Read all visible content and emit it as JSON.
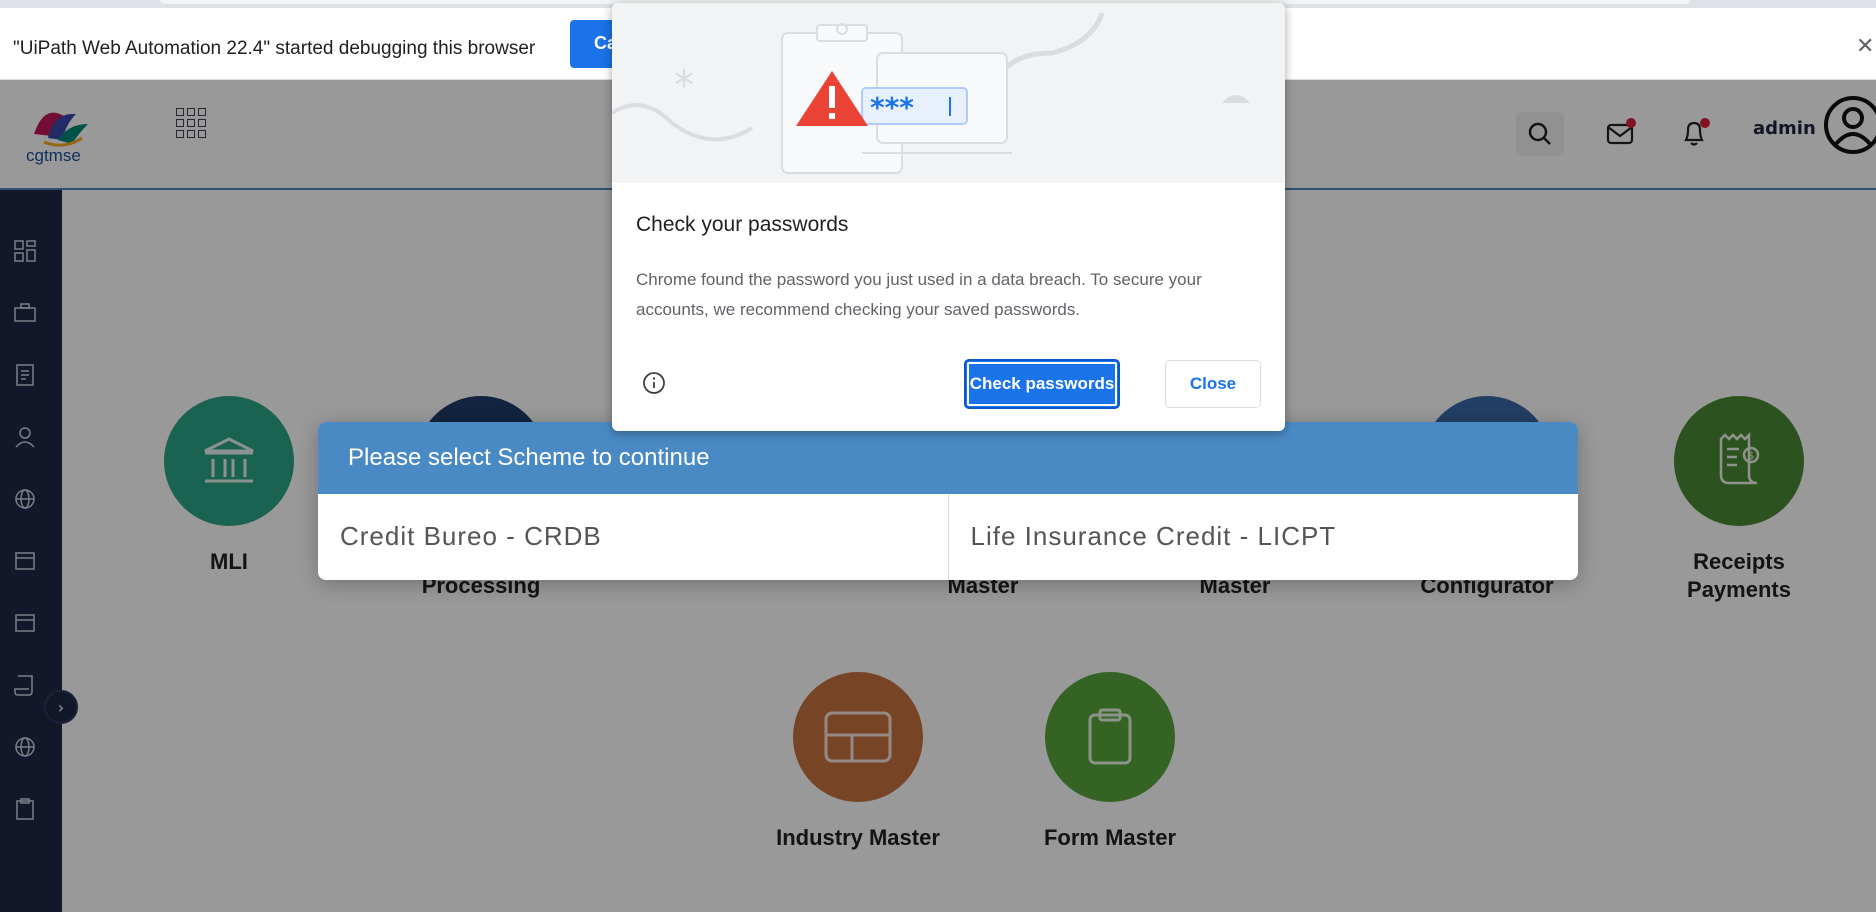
{
  "infobar": {
    "message": "\"UiPath Web Automation 22.4\" started debugging this browser",
    "cancel_label": "Ca",
    "close_glyph": "✕"
  },
  "header": {
    "logo_text": "cgtmse",
    "user_name": "admin",
    "icons": [
      "apps-grid-icon",
      "search-icon",
      "mail-icon",
      "bell-icon",
      "user-avatar-icon"
    ],
    "notification_color": "#d9203a"
  },
  "sidebar": {
    "icons": [
      "dashboard-icon",
      "briefcase-icon",
      "document-icon",
      "user-icon",
      "globe-icon",
      "calendar-icon",
      "calendar-icon",
      "scroll-icon",
      "globe-icon",
      "clipboard-icon"
    ],
    "collapse_glyph": "›"
  },
  "tiles": [
    {
      "label": "MLI",
      "color": "#2ea688",
      "icon": "bank-icon"
    },
    {
      "label": "Processing",
      "color": "#1e3d6b",
      "icon": "process-icon"
    },
    {
      "label": "Master",
      "color": "#3b6aa8",
      "icon": "master-icon"
    },
    {
      "label": "Master",
      "color": "#3b6aa8",
      "icon": "master-icon"
    },
    {
      "label": "Configurator",
      "color": "#3b6aa8",
      "icon": "config-icon"
    },
    {
      "label": "Receipts Payments",
      "color": "#4a8b35",
      "icon": "receipt-icon"
    },
    {
      "label": "Industry Master",
      "color": "#c87240",
      "icon": "layout-icon"
    },
    {
      "label": "Form Master",
      "color": "#58a53b",
      "icon": "clipboard-icon"
    }
  ],
  "scheme_modal": {
    "title": "Please select Scheme to continue",
    "options": [
      "Credit Bureo - CRDB",
      "Life Insurance Credit - LICPT"
    ],
    "header_color": "#4a8ac4"
  },
  "password_bubble": {
    "title": "Check your passwords",
    "body": "Chrome found the password you just used in a data breach. To secure your accounts, we recommend checking your saved passwords.",
    "check_label": "Check passwords",
    "close_label": "Close",
    "illustration_text": "***",
    "accent_color": "#1a73e8",
    "warning_color": "#ea4335"
  }
}
